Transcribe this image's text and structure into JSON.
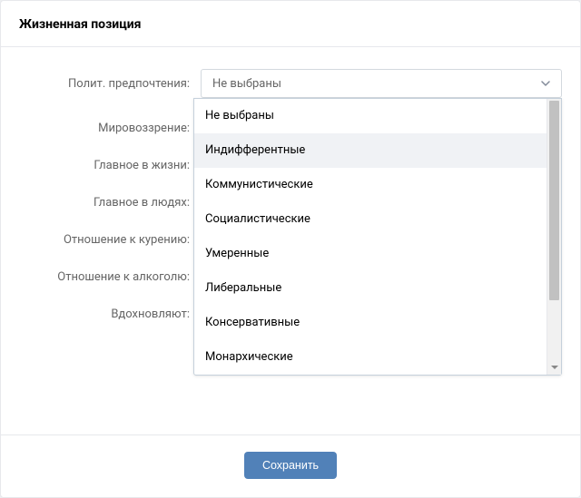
{
  "header": {
    "title": "Жизненная позиция"
  },
  "form": {
    "rows": [
      {
        "label": "Полит. предпочтения:",
        "value": "Не выбраны"
      },
      {
        "label": "Мировоззрение:"
      },
      {
        "label": "Главное в жизни:"
      },
      {
        "label": "Главное в людях:"
      },
      {
        "label": "Отношение к курению:"
      },
      {
        "label": "Отношение к алкоголю:"
      },
      {
        "label": "Вдохновляют:"
      }
    ]
  },
  "dropdown": {
    "options": [
      "Не выбраны",
      "Индифферентные",
      "Коммунистические",
      "Социалистические",
      "Умеренные",
      "Либеральные",
      "Консервативные",
      "Монархические"
    ],
    "highlighted_index": 1
  },
  "buttons": {
    "save": "Сохранить"
  },
  "colors": {
    "primary": "#5181b8",
    "border": "#e7e8ec",
    "muted_text": "#656565"
  }
}
